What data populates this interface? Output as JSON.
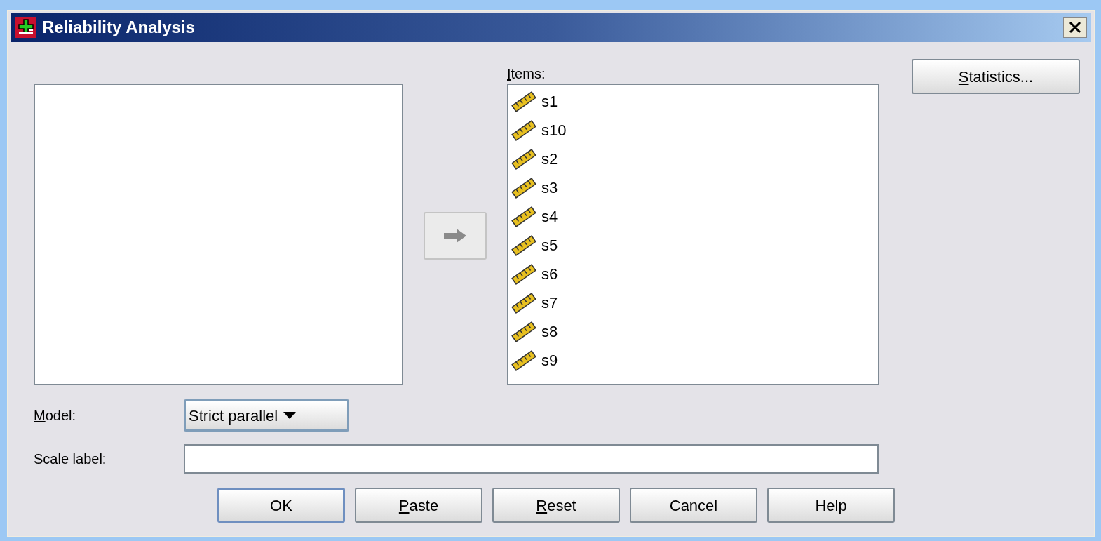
{
  "window": {
    "title": "Reliability Analysis"
  },
  "move_button": {
    "disabled": true
  },
  "items": {
    "label": "Items:",
    "underline_first": true,
    "variables": [
      {
        "name": "s1"
      },
      {
        "name": "s10"
      },
      {
        "name": "s2"
      },
      {
        "name": "s3"
      },
      {
        "name": "s4"
      },
      {
        "name": "s5"
      },
      {
        "name": "s6"
      },
      {
        "name": "s7"
      },
      {
        "name": "s8"
      },
      {
        "name": "s9"
      }
    ]
  },
  "side_buttons": [
    {
      "label": "Statistics...",
      "underline_first": true
    }
  ],
  "model": {
    "label": "Model:",
    "underline_first": true,
    "value": "Strict parallel"
  },
  "scale_label": {
    "label": "Scale label:",
    "underline_first": false
  },
  "buttons": [
    {
      "label": "OK",
      "underline_first": false,
      "default": true
    },
    {
      "label": "Paste",
      "underline_first": true,
      "default": false
    },
    {
      "label": "Reset",
      "underline_first": true,
      "default": false
    },
    {
      "label": "Cancel",
      "underline_first": false,
      "default": false
    },
    {
      "label": "Help",
      "underline_first": false,
      "default": false
    }
  ]
}
